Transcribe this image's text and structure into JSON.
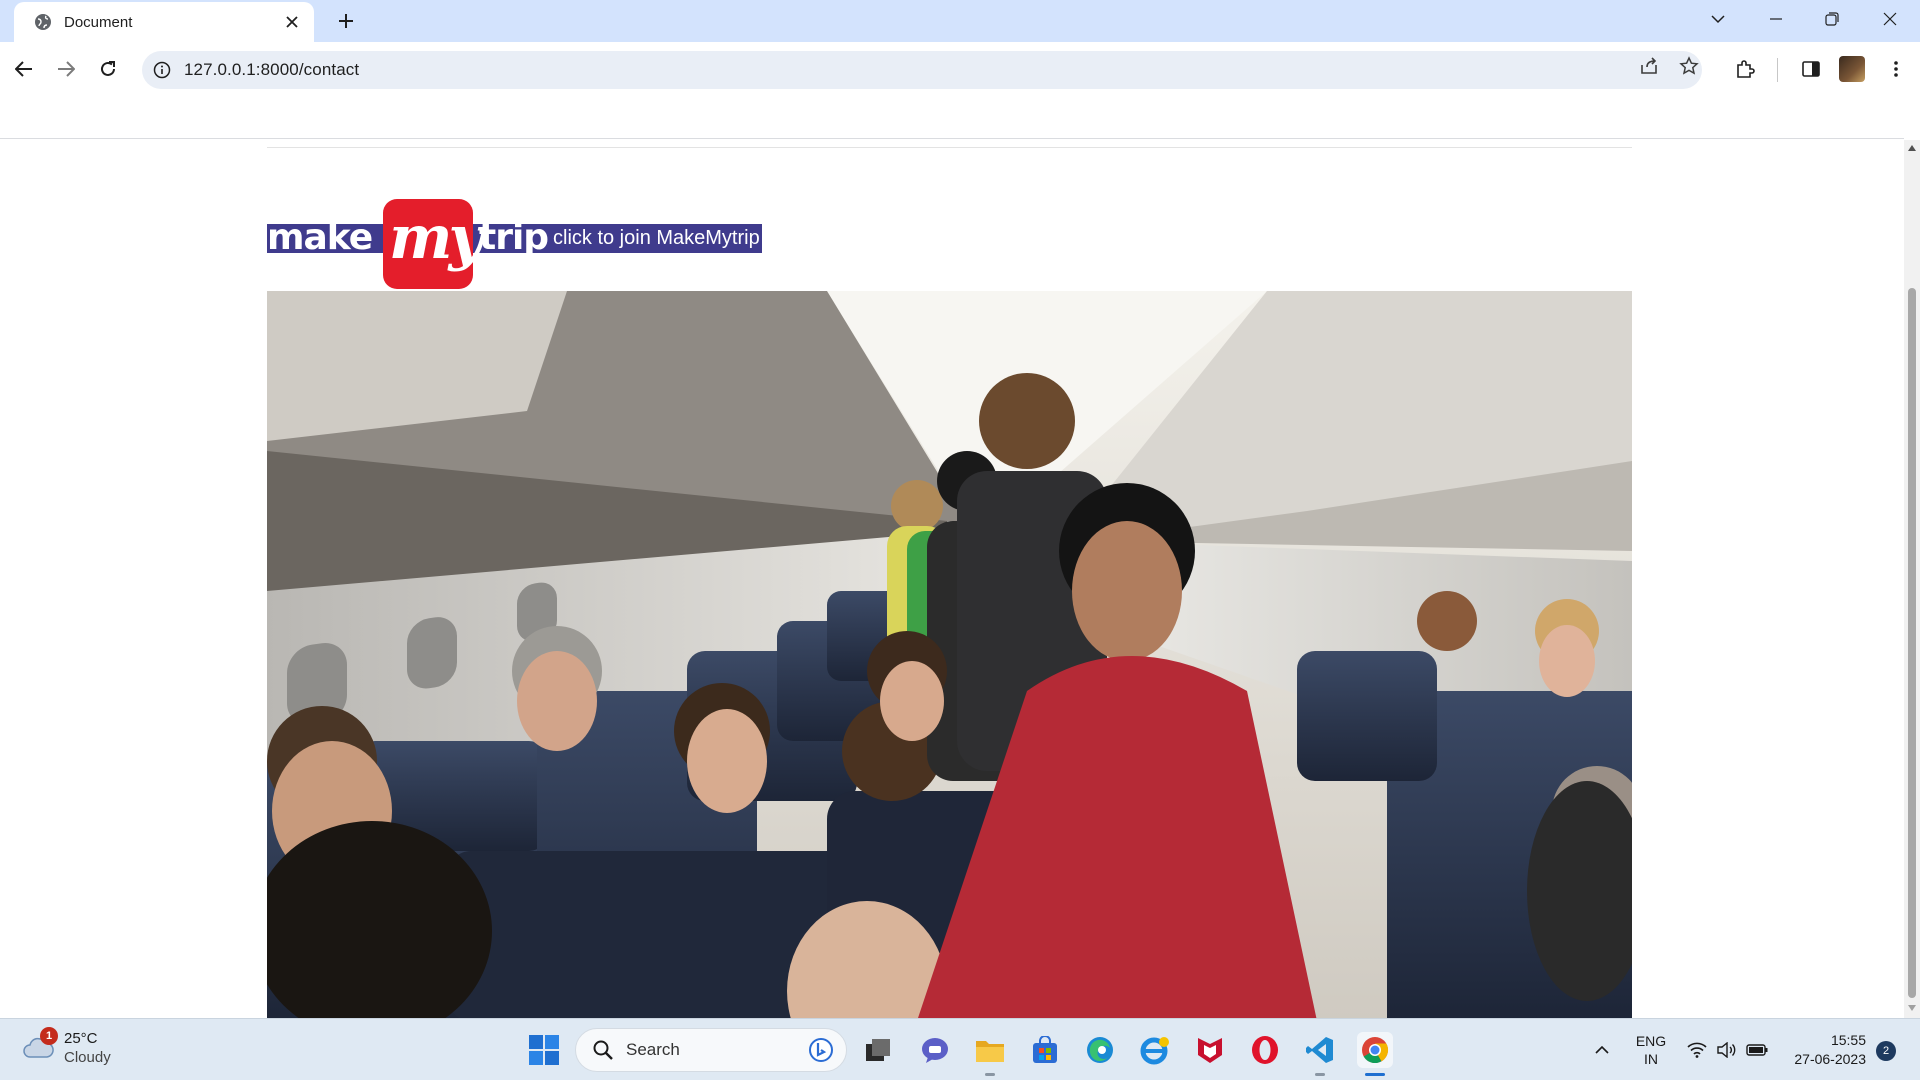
{
  "browser": {
    "tab_title": "Document",
    "url": "127.0.0.1:8000/contact"
  },
  "page": {
    "logo_alt": "makemytrip",
    "logo_text": {
      "part1": "make",
      "part2": "my",
      "part3": "trip"
    },
    "join_link_text": "click to join MakeMytrip",
    "colors": {
      "brand_band": "#3f3b8d",
      "brand_red": "#e41e2b"
    }
  },
  "taskbar": {
    "weather_badge": "1",
    "temperature": "25°C",
    "condition": "Cloudy",
    "search_label": "Search",
    "language_line1": "ENG",
    "language_line2": "IN",
    "time": "15:55",
    "date": "27-06-2023",
    "notification_count": "2"
  }
}
